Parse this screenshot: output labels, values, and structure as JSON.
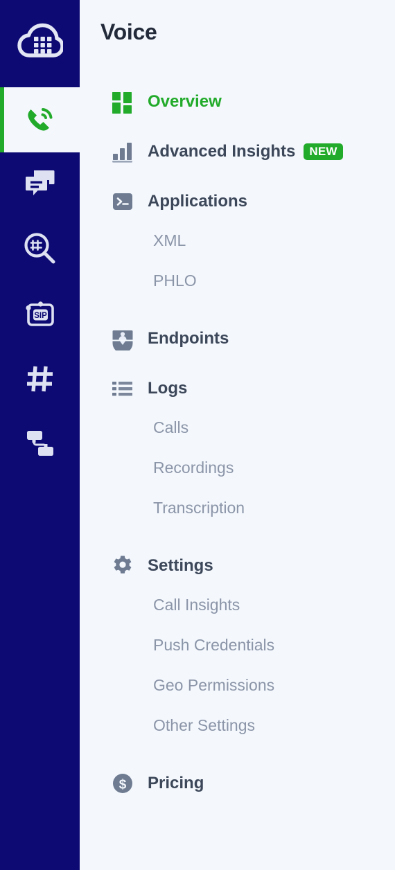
{
  "colors": {
    "rail_bg": "#0d0a73",
    "panel_bg": "#f4f8fd",
    "accent_green": "#22aa2a",
    "label_dark": "#3c4759",
    "label_muted": "#8b95a8",
    "title_dark": "#232b3a",
    "icon_gray": "#6e7b91",
    "badge_bg": "#22aa2a",
    "badge_text": "#ffffff"
  },
  "rail": {
    "logo": {
      "icon": "cloud-keypad-logo"
    },
    "items": [
      {
        "icon": "phone-signal-icon",
        "name": "voice",
        "active": true
      },
      {
        "icon": "messages-icon",
        "name": "messaging",
        "active": false
      },
      {
        "icon": "number-lookup-icon",
        "name": "lookup",
        "active": false
      },
      {
        "icon": "sip-trunk-icon",
        "name": "sip-trunking",
        "active": false
      },
      {
        "icon": "hash-numbers-icon",
        "name": "phone-numbers",
        "active": false
      },
      {
        "icon": "flow-nodes-icon",
        "name": "flows",
        "active": false
      }
    ]
  },
  "main": {
    "title": "Voice",
    "nav": [
      {
        "id": "overview",
        "label": "Overview",
        "icon": "grid-blocks-icon",
        "active": true,
        "badge": null
      },
      {
        "id": "advanced-insights",
        "label": "Advanced Insights",
        "icon": "bar-chart-icon",
        "active": false,
        "badge": "NEW"
      },
      {
        "id": "applications",
        "label": "Applications",
        "icon": "terminal-icon",
        "active": false,
        "badge": null,
        "children": [
          {
            "id": "xml",
            "label": "XML"
          },
          {
            "id": "phlo",
            "label": "PHLO"
          }
        ]
      },
      {
        "id": "endpoints",
        "label": "Endpoints",
        "icon": "person-card-icon",
        "active": false,
        "badge": null
      },
      {
        "id": "logs",
        "label": "Logs",
        "icon": "list-icon",
        "active": false,
        "badge": null,
        "children": [
          {
            "id": "calls",
            "label": "Calls"
          },
          {
            "id": "recordings",
            "label": "Recordings"
          },
          {
            "id": "transcription",
            "label": "Transcription"
          }
        ]
      },
      {
        "id": "settings",
        "label": "Settings",
        "icon": "gear-icon",
        "active": false,
        "badge": null,
        "children": [
          {
            "id": "call-insights",
            "label": "Call Insights"
          },
          {
            "id": "push-credentials",
            "label": "Push Credentials"
          },
          {
            "id": "geo-permissions",
            "label": "Geo Permissions"
          },
          {
            "id": "other-settings",
            "label": "Other Settings"
          }
        ]
      },
      {
        "id": "pricing",
        "label": "Pricing",
        "icon": "dollar-circle-icon",
        "active": false,
        "badge": null
      }
    ]
  }
}
